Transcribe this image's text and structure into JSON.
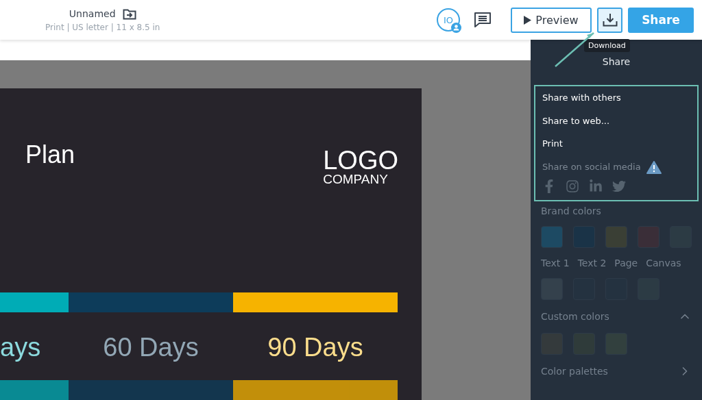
{
  "header": {
    "title": "Unnamed",
    "subtitle": "Print | US letter | 11 x 8.5 in",
    "avatar": "IO",
    "preview": "Preview",
    "share": "Share",
    "download_tooltip": "Download"
  },
  "share_menu": {
    "title": "Share",
    "items": [
      {
        "label": "Share with others",
        "disabled": false
      },
      {
        "label": "Share to web...",
        "disabled": false
      },
      {
        "label": "Print",
        "disabled": false
      },
      {
        "label": "Share on social media",
        "disabled": true
      }
    ]
  },
  "document": {
    "title": "Plan",
    "logo": "LOGO",
    "company": "COMPANY",
    "phases": [
      {
        "label": "ays",
        "color": "#00acb6"
      },
      {
        "label": "60 Days",
        "color": "#0d3c5a"
      },
      {
        "label": "90 Days",
        "color": "#f6b300"
      }
    ]
  },
  "panel": {
    "brand_colors": {
      "title": "Brand colors",
      "swatches": [
        {
          "color": "#1d4a63"
        },
        {
          "color": "#1a3347"
        },
        {
          "color": "#3a3f35"
        },
        {
          "color": "#3a2e38"
        },
        {
          "color": "#2c3b44"
        }
      ]
    },
    "roles": [
      {
        "label": "Text 1",
        "color": "#34414c"
      },
      {
        "label": "Text 2",
        "color": "#243240"
      },
      {
        "label": "Page",
        "color": "#243240"
      },
      {
        "label": "Canvas",
        "color": "#2c3b44"
      }
    ],
    "custom_colors": {
      "title": "Custom colors",
      "expanded": true,
      "swatches": [
        {
          "color": "#343a3c"
        },
        {
          "color": "#2f3b3a"
        },
        {
          "color": "#32403e"
        }
      ]
    },
    "palettes": "Color palettes"
  }
}
